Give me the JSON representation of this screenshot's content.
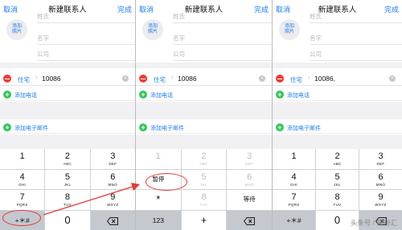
{
  "screens": [
    {
      "nav": {
        "cancel": "取消",
        "title": "新建联系人",
        "done": "完成"
      },
      "photo": {
        "line1": "添加",
        "line2": "照片"
      },
      "fields": {
        "last_name": "姓氏",
        "first_name": "名字",
        "company": "公司"
      },
      "phone": {
        "type": "住宅",
        "value": "10086"
      },
      "add_phone": "添加电话",
      "add_email": "添加电子邮件",
      "keys": [
        {
          "digit": "1",
          "letters": ""
        },
        {
          "digit": "2",
          "letters": "ABC"
        },
        {
          "digit": "3",
          "letters": "DEF"
        },
        {
          "digit": "4",
          "letters": "GHI"
        },
        {
          "digit": "5",
          "letters": "JKL"
        },
        {
          "digit": "6",
          "letters": "MNO"
        },
        {
          "digit": "7",
          "letters": "PQRS"
        },
        {
          "digit": "8",
          "letters": "TUV"
        },
        {
          "digit": "9",
          "letters": "WXYZ"
        }
      ],
      "bottom": {
        "symbols": "+＊#",
        "zero": "0"
      }
    },
    {
      "nav": {
        "cancel": "取消",
        "title": "新建联系人",
        "done": "完成"
      },
      "photo": {
        "line1": "添加",
        "line2": "照片"
      },
      "fields": {
        "last_name": "姓氏",
        "first_name": "名字",
        "company": "公司"
      },
      "phone": {
        "type": "住宅",
        "value": "10086"
      },
      "add_phone": "添加电话",
      "add_email": "添加电子邮件",
      "keys": {
        "row1": [
          {
            "digit": "1",
            "letters": ""
          },
          {
            "digit": "2",
            "letters": "ABC"
          },
          {
            "digit": "3",
            "letters": "DEF"
          }
        ],
        "pause": "暂停",
        "five": {
          "digit": "5",
          "letters": "JKL"
        },
        "six": {
          "digit": "6",
          "letters": "MNO"
        },
        "star": "*",
        "eight": {
          "digit": "8",
          "letters": "TUV"
        },
        "wait": "等待"
      },
      "bottom": {
        "numbers": "123",
        "plus": "+",
        "hash": "#"
      }
    },
    {
      "nav": {
        "cancel": "取消",
        "title": "新建联系人",
        "done": "完成"
      },
      "photo": {
        "line1": "添加",
        "line2": "照片"
      },
      "fields": {
        "last_name": "姓氏",
        "first_name": "名字",
        "company": "公司"
      },
      "phone": {
        "type": "住宅",
        "value": "10086,"
      },
      "add_phone": "添加电话",
      "add_email": "添加电子邮件",
      "keys": [
        {
          "digit": "1",
          "letters": ""
        },
        {
          "digit": "2",
          "letters": "ABC"
        },
        {
          "digit": "3",
          "letters": "DEF"
        },
        {
          "digit": "4",
          "letters": "GHI"
        },
        {
          "digit": "5",
          "letters": "JKL"
        },
        {
          "digit": "6",
          "letters": "MNO"
        },
        {
          "digit": "7",
          "letters": "PQRS"
        },
        {
          "digit": "8",
          "letters": "TUV"
        },
        {
          "digit": "9",
          "letters": "WXYZ"
        }
      ],
      "bottom": {
        "symbols": "+＊#",
        "zero": "0"
      }
    }
  ],
  "watermark": "头条号 / 果粉汇",
  "colors": {
    "accent": "#1a7cf5",
    "delete": "#f23b30",
    "add": "#33c759",
    "annotation": "#e53935"
  },
  "icons": {
    "delete_key": "backspace-icon",
    "remove_phone": "minus-circle-icon",
    "add_row": "plus-circle-icon",
    "clear_field": "clear-icon"
  }
}
